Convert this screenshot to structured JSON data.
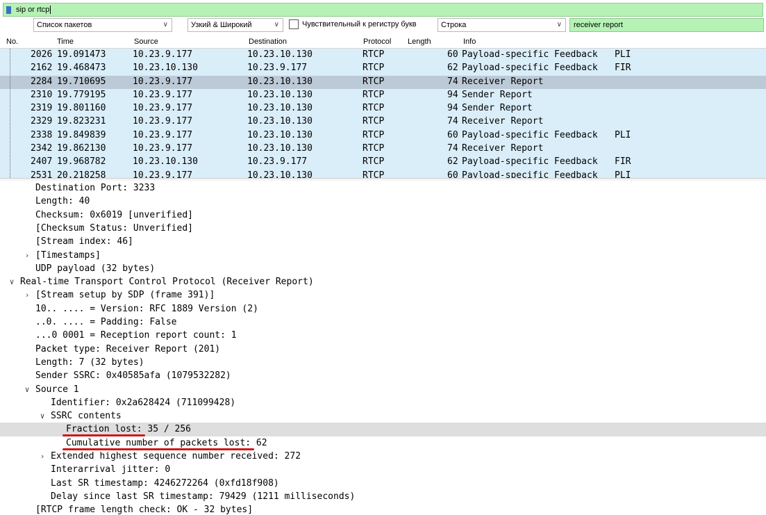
{
  "filter": {
    "text": "sip or rtcp"
  },
  "find": {
    "search_in": "Список пакетов",
    "char_width": "Узкий & Широкий",
    "case_label": "Чувствительный к регистру букв",
    "search_type": "Строка",
    "query": "receiver report"
  },
  "columns": {
    "no": "No.",
    "time": "Time",
    "source": "Source",
    "destination": "Destination",
    "protocol": "Protocol",
    "length": "Length",
    "info": "Info"
  },
  "packets": [
    {
      "no": "2026",
      "time": "19.091473",
      "src": "10.23.9.177",
      "dst": "10.23.10.130",
      "proto": "RTCP",
      "len": "60",
      "info": "Payload-specific Feedback",
      "extra": "PLI"
    },
    {
      "no": "2162",
      "time": "19.468473",
      "src": "10.23.10.130",
      "dst": "10.23.9.177",
      "proto": "RTCP",
      "len": "62",
      "info": "Payload-specific Feedback",
      "extra": "FIR"
    },
    {
      "no": "2284",
      "time": "19.710695",
      "src": "10.23.9.177",
      "dst": "10.23.10.130",
      "proto": "RTCP",
      "len": "74",
      "info": "Receiver Report",
      "extra": ""
    },
    {
      "no": "2310",
      "time": "19.779195",
      "src": "10.23.9.177",
      "dst": "10.23.10.130",
      "proto": "RTCP",
      "len": "94",
      "info": "Sender Report",
      "extra": ""
    },
    {
      "no": "2319",
      "time": "19.801160",
      "src": "10.23.9.177",
      "dst": "10.23.10.130",
      "proto": "RTCP",
      "len": "94",
      "info": "Sender Report",
      "extra": ""
    },
    {
      "no": "2329",
      "time": "19.823231",
      "src": "10.23.9.177",
      "dst": "10.23.10.130",
      "proto": "RTCP",
      "len": "74",
      "info": "Receiver Report",
      "extra": ""
    },
    {
      "no": "2338",
      "time": "19.849839",
      "src": "10.23.9.177",
      "dst": "10.23.10.130",
      "proto": "RTCP",
      "len": "60",
      "info": "Payload-specific Feedback",
      "extra": "PLI"
    },
    {
      "no": "2342",
      "time": "19.862130",
      "src": "10.23.9.177",
      "dst": "10.23.10.130",
      "proto": "RTCP",
      "len": "74",
      "info": "Receiver Report",
      "extra": ""
    },
    {
      "no": "2407",
      "time": "19.968782",
      "src": "10.23.10.130",
      "dst": "10.23.9.177",
      "proto": "RTCP",
      "len": "62",
      "info": "Payload-specific Feedback",
      "extra": "FIR"
    },
    {
      "no": "2531",
      "time": "20.218258",
      "src": "10.23.9.177",
      "dst": "10.23.10.130",
      "proto": "RTCP",
      "len": "60",
      "info": "Payload-specific Feedback",
      "extra": "PLI"
    }
  ],
  "details": [
    {
      "text": "Destination Port: 3233"
    },
    {
      "text": "Length: 40"
    },
    {
      "text": "Checksum: 0x6019 [unverified]"
    },
    {
      "text": "[Checksum Status: Unverified]"
    },
    {
      "text": "[Stream index: 46]"
    },
    {
      "text": "[Timestamps]"
    },
    {
      "text": "UDP payload (32 bytes)"
    },
    {
      "text": "Real-time Transport Control Protocol (Receiver Report)"
    },
    {
      "text": "[Stream setup by SDP (frame 391)]"
    },
    {
      "text": "10.. .... = Version: RFC 1889 Version (2)"
    },
    {
      "text": "..0. .... = Padding: False"
    },
    {
      "text": "...0 0001 = Reception report count: 1"
    },
    {
      "text": "Packet type: Receiver Report (201)"
    },
    {
      "text": "Length: 7 (32 bytes)"
    },
    {
      "text": "Sender SSRC: 0x40585afa (1079532282)"
    },
    {
      "text": "Source 1"
    },
    {
      "text": "Identifier: 0x2a628424 (711099428)"
    },
    {
      "text": "SSRC contents"
    },
    {
      "text": "Fraction lost: 35 / 256"
    },
    {
      "text": "Cumulative number of packets lost: 62"
    },
    {
      "text": "Extended highest sequence number received: 272"
    },
    {
      "text": "Interarrival jitter: 0"
    },
    {
      "text": "Last SR timestamp: 4246272264 (0xfd18f908)"
    },
    {
      "text": "Delay since last SR timestamp: 79429 (1211 milliseconds)"
    },
    {
      "text": "[RTCP frame length check: OK - 32 bytes]"
    }
  ]
}
